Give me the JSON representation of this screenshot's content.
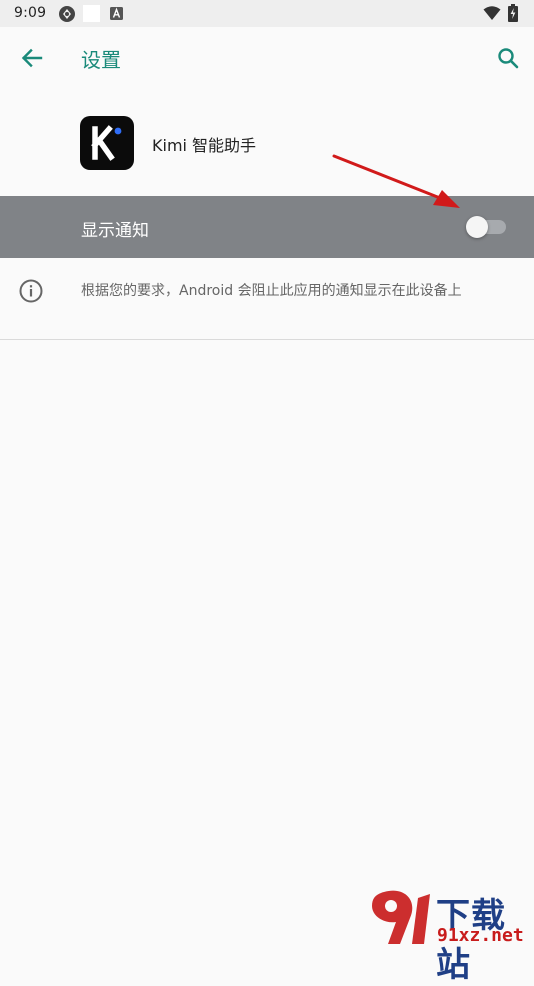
{
  "status_bar": {
    "time": "9:09",
    "icons": [
      "sync-icon",
      "white-square-icon",
      "accessibility-a-icon",
      "wifi-icon",
      "battery-charging-icon"
    ]
  },
  "app_bar": {
    "title": "设置",
    "back_icon": "back-arrow-icon",
    "search_icon": "search-icon",
    "accent_color": "#1a8a7a"
  },
  "app": {
    "name": "Kimi 智能助手",
    "icon_letter": "K"
  },
  "notification": {
    "label": "显示通知",
    "enabled": false
  },
  "info": {
    "text": "根据您的要求，Android 会阻止此应用的通知显示在此设备上"
  },
  "annotation": {
    "arrow_color": "#d11a1a"
  },
  "watermark": {
    "brand": "下载站",
    "domain": "91xz.net"
  }
}
